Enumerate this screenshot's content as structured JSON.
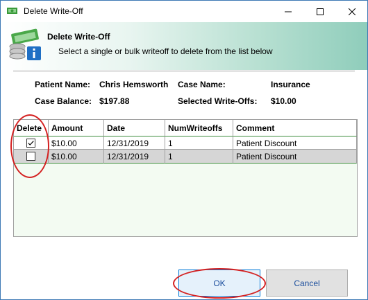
{
  "window": {
    "title": "Delete Write-Off"
  },
  "banner": {
    "title": "Delete Write-Off",
    "subtitle": "Select a single or bulk writeoff to delete from the list below"
  },
  "info": {
    "patient_name_label": "Patient Name:",
    "patient_name_value": "Chris Hemsworth",
    "case_name_label": "Case Name:",
    "case_name_value": "Insurance",
    "case_balance_label": "Case Balance:",
    "case_balance_value": "$197.88",
    "selected_writeoffs_label": "Selected Write-Offs:",
    "selected_writeoffs_value": "$10.00"
  },
  "grid": {
    "columns": [
      "Delete",
      "Amount",
      "Date",
      "NumWriteoffs",
      "Comment"
    ],
    "rows": [
      {
        "checked": true,
        "amount": "$10.00",
        "date": "12/31/2019",
        "num": "1",
        "comment": "Patient Discount"
      },
      {
        "checked": false,
        "amount": "$10.00",
        "date": "12/31/2019",
        "num": "1",
        "comment": "Patient Discount"
      }
    ]
  },
  "buttons": {
    "ok": "OK",
    "cancel": "Cancel"
  },
  "colors": {
    "annotation_red": "#d42020",
    "grid_background": "#f3fbf2",
    "selected_row_border": "#3c8c3c"
  }
}
